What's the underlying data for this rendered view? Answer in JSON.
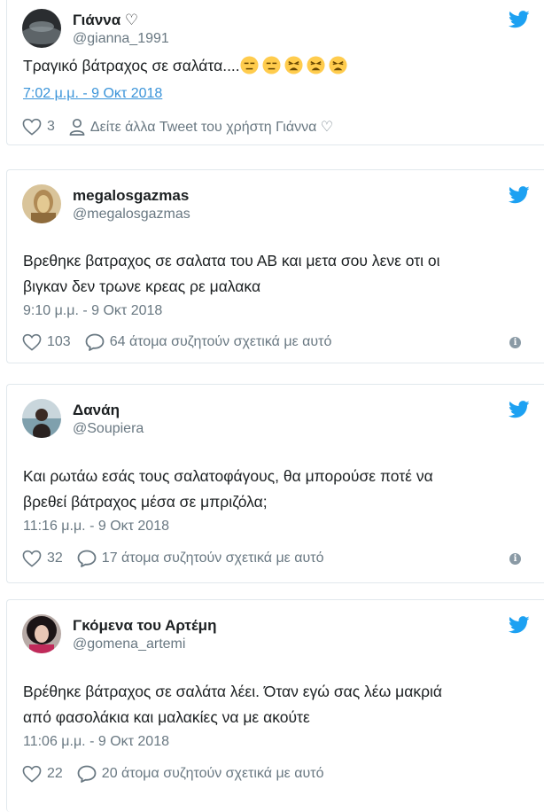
{
  "colors": {
    "accent": "#1da1f2",
    "link": "#3b94d9",
    "muted": "#697882",
    "border": "#e1e8ed"
  },
  "tweets": [
    {
      "name": "Γιάννα ♡",
      "handle": "@gianna_1991",
      "text": "Τραγικό βάτραχος σε σαλάτα....",
      "emojis": [
        "expressionless-face",
        "expressionless-face",
        "weary-face",
        "weary-face",
        "weary-face"
      ],
      "time": "7:02 μ.μ. - 9 Οκτ 2018",
      "likes": "3",
      "more": "Δείτε άλλα Tweet του χρήστη Γιάννα ♡"
    },
    {
      "name": "megalosgazmas",
      "handle": "@megalosgazmas",
      "text_line1": "Βρεθηκε βατραχος σε σαλατα του ΑΒ και μετα σου λενε οτι οι",
      "text_line2": "βιγκαν δεν τρωνε κρεας ρε μαλακα",
      "time": "9:10 μ.μ. - 9 Οκτ 2018",
      "likes": "103",
      "talking": "64 άτομα συζητούν σχετικά με αυτό"
    },
    {
      "name": "Δανάη",
      "handle": "@Soupiera",
      "text_line1": "Και ρωτάω εσάς τους σαλατοφάγους, θα μπορούσε ποτέ να",
      "text_line2": "βρεθεί βάτραχος μέσα σε μπριζόλα;",
      "time": "11:16 μ.μ. - 9 Οκτ 2018",
      "likes": "32",
      "talking": "17 άτομα συζητούν σχετικά με αυτό"
    },
    {
      "name": "Γκόμενα του Αρτέμη",
      "handle": "@gomena_artemi",
      "text_line1": "Βρέθηκε βάτραχος σε σαλάτα λέει. Όταν εγώ σας λέω μακριά",
      "text_line2": "από φασολάκια και μαλακίες να με ακούτε",
      "time": "11:06 μ.μ. - 9 Οκτ 2018",
      "likes": "22",
      "talking": "20 άτομα συζητούν σχετικά με αυτό"
    }
  ]
}
